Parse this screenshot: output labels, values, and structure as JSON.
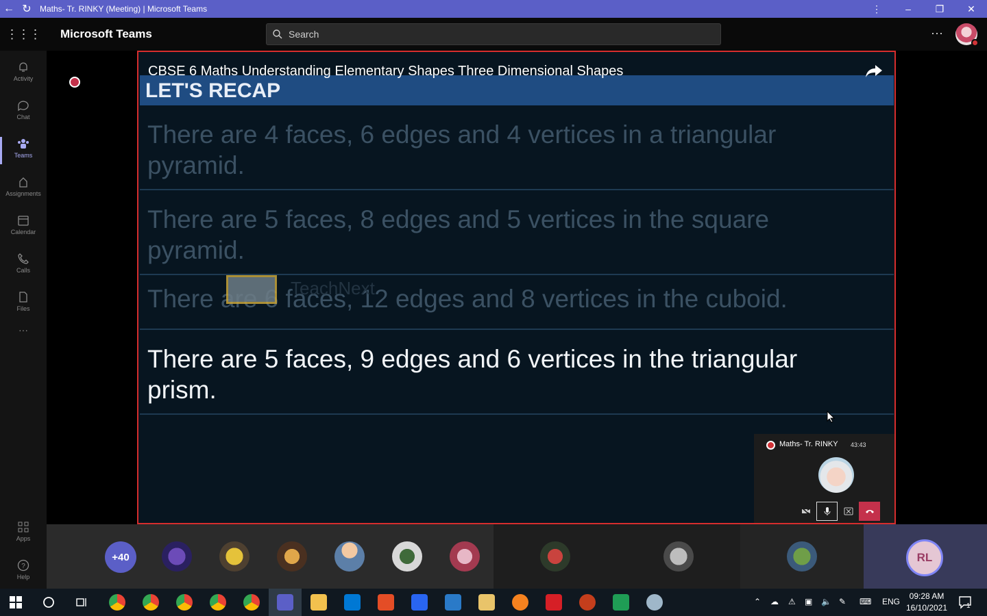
{
  "window": {
    "title": "Maths- Tr. RINKY (Meeting) | Microsoft Teams"
  },
  "header": {
    "app_name": "Microsoft Teams",
    "search_placeholder": "Search"
  },
  "rail": {
    "items": [
      {
        "label": "Activity",
        "icon": "bell-icon"
      },
      {
        "label": "Chat",
        "icon": "chat-icon"
      },
      {
        "label": "Teams",
        "icon": "teams-icon",
        "active": true
      },
      {
        "label": "Assignments",
        "icon": "assignments-icon"
      },
      {
        "label": "Calendar",
        "icon": "calendar-icon"
      },
      {
        "label": "Calls",
        "icon": "phone-icon"
      },
      {
        "label": "Files",
        "icon": "file-icon"
      }
    ],
    "bottom": [
      {
        "label": "Apps",
        "icon": "apps-icon"
      },
      {
        "label": "Help",
        "icon": "help-icon"
      }
    ]
  },
  "shared_content": {
    "video_title": "CBSE 6 Maths Understanding Elementary Shapes Three Dimensional Shapes",
    "slide_heading": "LET'S RECAP",
    "rows": [
      "There are 4 faces,  6 edges and 4 vertices in a triangular pyramid.",
      "There are 5 faces,  8 edges and  5 vertices in the square pyramid.",
      "There are 6 faces, 12 edges and 8 vertices in the cuboid.",
      "There are 5 faces,  9 edges and 6 vertices in the triangular prism."
    ],
    "highlighted_row": 3,
    "watermark": "TeachNext"
  },
  "mini_panel": {
    "meeting_name": "Maths- Tr. RINKY",
    "timer": "43:43"
  },
  "participants": {
    "overflow_count": "+40",
    "self_initials": "RL"
  },
  "taskbar": {
    "language": "ENG",
    "time": "09:28 AM",
    "date": "16/10/2021",
    "notification_count": "1"
  },
  "colors": {
    "titlebar": "#5b5fc7",
    "accent": "#7f85f5",
    "share_border": "#d62d2d",
    "recap_band": "#1f4c82",
    "hangup": "#c4314b"
  }
}
